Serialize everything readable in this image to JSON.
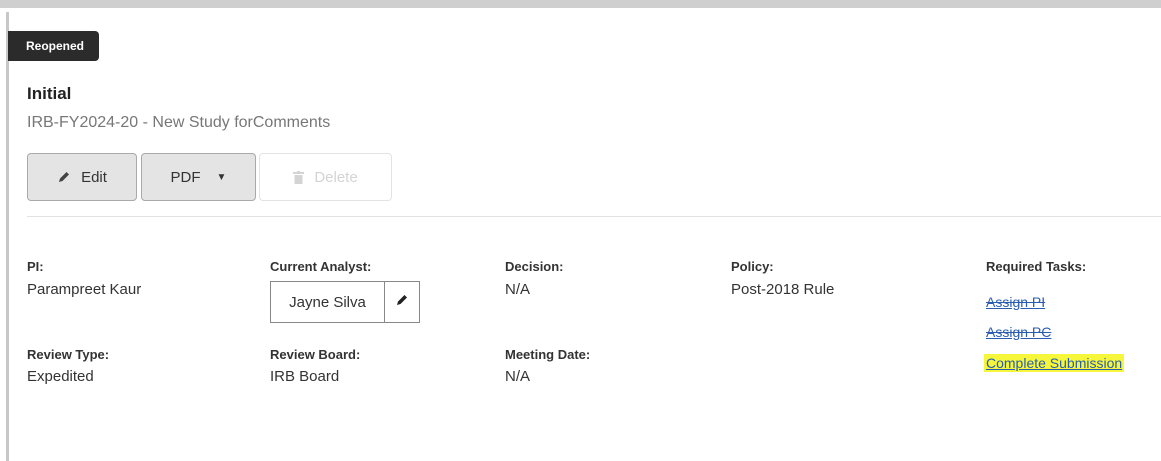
{
  "status_badge": "Reopened",
  "header": {
    "title": "Initial",
    "subtitle": "IRB-FY2024-20 - New Study forComments"
  },
  "toolbar": {
    "edit_label": "Edit",
    "pdf_label": "PDF",
    "delete_label": "Delete"
  },
  "details": {
    "pi": {
      "label": "PI:",
      "value": "Parampreet Kaur"
    },
    "current_analyst": {
      "label": "Current Analyst:",
      "value": "Jayne Silva"
    },
    "decision": {
      "label": "Decision:",
      "value": "N/A"
    },
    "policy": {
      "label": "Policy:",
      "value": "Post-2018 Rule"
    },
    "review_type": {
      "label": "Review Type:",
      "value": "Expedited"
    },
    "review_board": {
      "label": "Review Board:",
      "value": "IRB Board"
    },
    "meeting_date": {
      "label": "Meeting Date:",
      "value": "N/A"
    }
  },
  "required_tasks": {
    "label": "Required Tasks:",
    "items": [
      {
        "label": "Assign PI",
        "completed": true
      },
      {
        "label": "Assign PC",
        "completed": true
      },
      {
        "label": "Complete Submission",
        "completed": false,
        "highlighted": true
      }
    ]
  },
  "colors": {
    "badge_bg": "#2b2b2b",
    "link": "#2a5db0",
    "highlight": "#f6f73a"
  },
  "icons": {
    "edit": "pencil-icon",
    "pdf_dropdown": "caret-down-icon",
    "delete": "trash-icon",
    "analyst_edit": "pencil-icon"
  }
}
